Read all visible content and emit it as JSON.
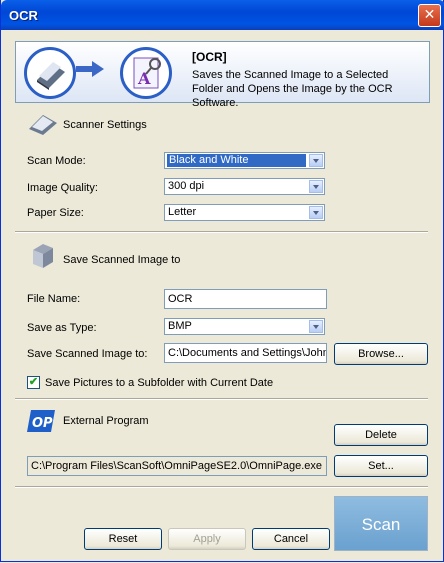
{
  "window": {
    "title": "OCR"
  },
  "header": {
    "title": "[OCR]",
    "description": "Saves the Scanned Image to a Selected Folder and Opens the Image by the OCR Software."
  },
  "scanner": {
    "heading": "Scanner Settings",
    "scan_mode_label": "Scan Mode:",
    "scan_mode_value": "Black and White",
    "quality_label": "Image Quality:",
    "quality_value": "300 dpi",
    "paper_label": "Paper Size:",
    "paper_value": "Letter"
  },
  "save": {
    "heading": "Save Scanned Image to",
    "file_name_label": "File Name:",
    "file_name_value": "OCR",
    "type_label": "Save as Type:",
    "type_value": "BMP",
    "path_label": "Save Scanned Image to:",
    "path_value": "C:\\Documents and Settings\\John",
    "browse_label": "Browse...",
    "subfolder_label": "Save Pictures to a Subfolder with Current Date",
    "subfolder_checked": true
  },
  "external": {
    "heading": "External Program",
    "delete_label": "Delete",
    "program_path": "C:\\Program Files\\ScanSoft\\OmniPageSE2.0\\OmniPage.exe",
    "set_label": "Set..."
  },
  "footer": {
    "reset_label": "Reset",
    "apply_label": "Apply",
    "cancel_label": "Cancel",
    "scan_label": "Scan"
  },
  "colors": {
    "titlebar": "#0054e3",
    "selection": "#316ac5",
    "scan_button": "#7aaed8"
  }
}
